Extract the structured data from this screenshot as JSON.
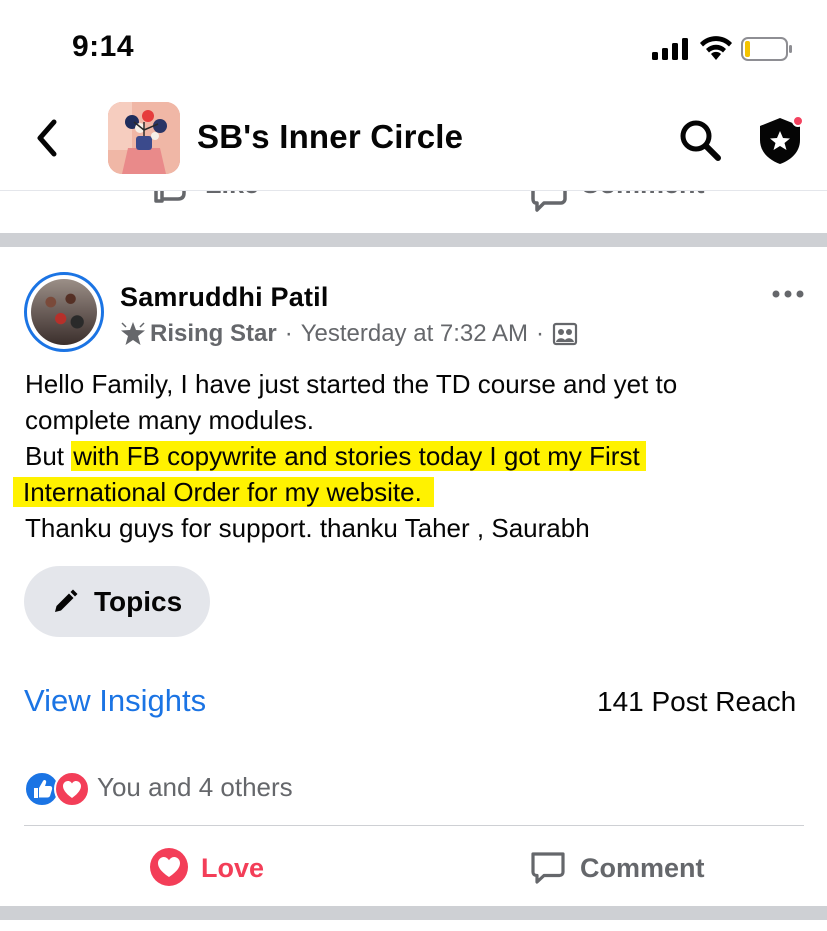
{
  "status_bar": {
    "time": "9:14"
  },
  "header": {
    "title": "SB's Inner Circle"
  },
  "previous_post": {
    "like_label": "Like",
    "comment_label": "Comment"
  },
  "post": {
    "author": "Samruddhi Patil",
    "badge": "Rising Star",
    "timestamp": "Yesterday at 7:32 AM",
    "separator": "·",
    "text": {
      "line1": "Hello Family, I have just started the TD course and yet to",
      "line2": "complete many modules.",
      "line3_prefix": "But ",
      "line3_highlight": "with FB copywrite and stories today I got my First",
      "line4_highlight": "International Order for my website.",
      "line5": "Thanku guys for support. thanku Taher , Saurabh"
    },
    "topics_label": "Topics",
    "insights_label": "View Insights",
    "reach_label": "141 Post Reach",
    "reactions_text": "You and 4 others",
    "love_label": "Love",
    "comment_label": "Comment"
  },
  "colors": {
    "accent": "#1b74e4",
    "love": "#f33e58",
    "highlight": "#fff200",
    "secondary_text": "#65676b"
  }
}
